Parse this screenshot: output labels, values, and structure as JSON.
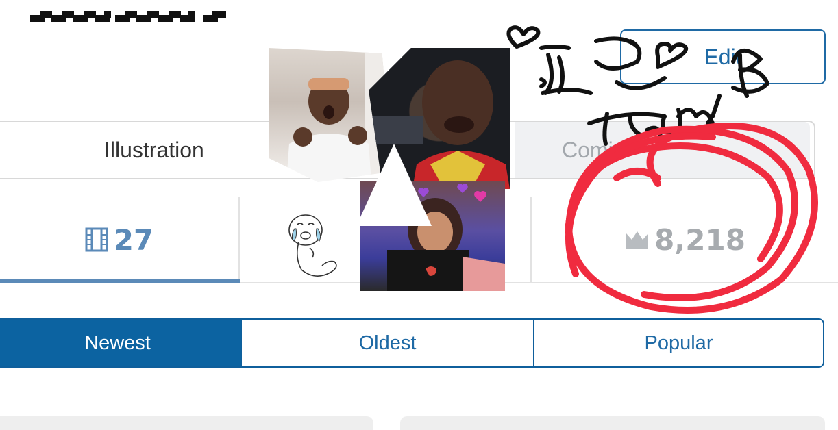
{
  "header": {
    "edit_label": "Edit"
  },
  "category_tabs": {
    "illustration": "Illustration",
    "comic": "Comi"
  },
  "stats": {
    "works_count": "27",
    "works_icon": "film-icon",
    "rank_value": "8,218",
    "rank_icon": "crown-icon"
  },
  "sort_tabs": {
    "newest": "Newest",
    "oldest": "Oldest",
    "popular": "Popular",
    "active": "newest"
  },
  "overlay": {
    "handwriting": "tysm!B"
  },
  "colors": {
    "accent": "#0c63a1",
    "link": "#1f6aa5",
    "works_stat": "#5b8ab8",
    "scribble_red": "#f02b3f"
  }
}
